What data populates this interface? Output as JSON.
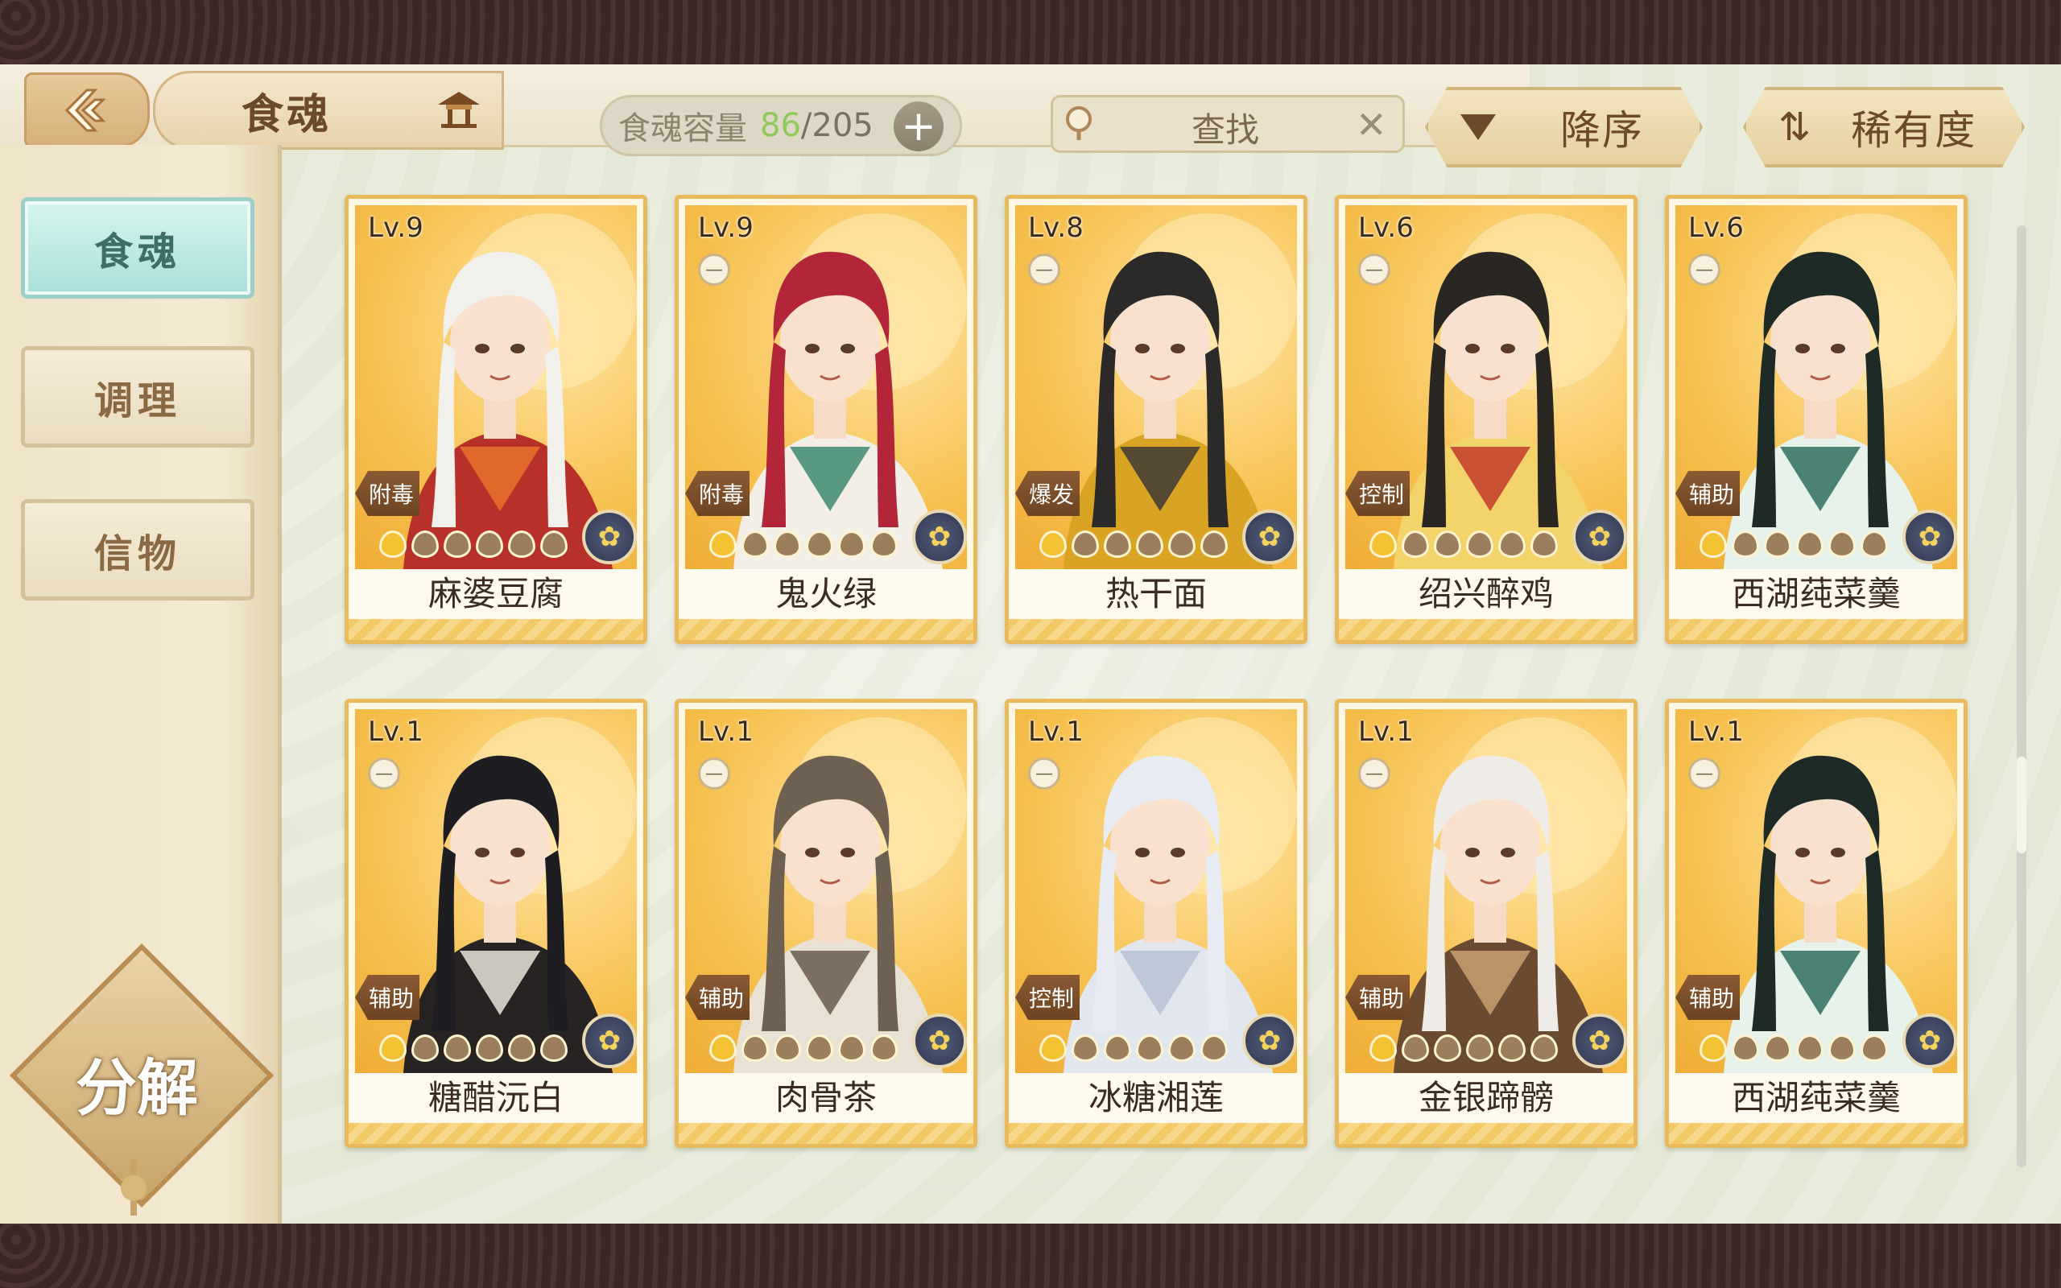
{
  "header": {
    "title": "食魂",
    "capacity_label": "食魂容量",
    "capacity_current": "86",
    "capacity_separator": "/",
    "capacity_max": "205",
    "add_symbol": "+",
    "search_placeholder": "查找",
    "clear_symbol": "✕",
    "sort_order_label": "降序",
    "sort_key_label": "稀有度"
  },
  "sidebar": {
    "tabs": [
      {
        "label": "食魂",
        "active": true
      },
      {
        "label": "调理",
        "active": false
      },
      {
        "label": "信物",
        "active": false
      }
    ],
    "decompose_label": "分解"
  },
  "cards": [
    {
      "level": "Lv.9",
      "name": "麻婆豆腐",
      "role": "附毒",
      "stars_lit": 1,
      "seal": "blue-flower-seal-icon",
      "palette": {
        "hair": "#f2f0ea",
        "outfit": "#b8302a",
        "accent": "#e8722c"
      }
    },
    {
      "level": "Lv.9",
      "name": "鬼火绿",
      "role": "附毒",
      "stars_lit": 1,
      "seal": "blue-flower-seal-icon",
      "palette": {
        "hair": "#b3263a",
        "outfit": "#f4efe6",
        "accent": "#3d8a6e"
      }
    },
    {
      "level": "Lv.8",
      "name": "热干面",
      "role": "爆发",
      "stars_lit": 1,
      "seal": "gold-flower-seal-icon",
      "palette": {
        "hair": "#2c2a28",
        "outfit": "#d9a424",
        "accent": "#3d3a36"
      }
    },
    {
      "level": "Lv.6",
      "name": "绍兴醉鸡",
      "role": "控制",
      "stars_lit": 1,
      "seal": "gold-flower-seal-icon",
      "palette": {
        "hair": "#2a2622",
        "outfit": "#f2d46a",
        "accent": "#c43a2a"
      }
    },
    {
      "level": "Lv.6",
      "name": "西湖莼菜羹",
      "role": "辅助",
      "stars_lit": 1,
      "seal": "gold-flower-seal-icon",
      "palette": {
        "hair": "#1e2a26",
        "outfit": "#e6f2ea",
        "accent": "#2f6e5e"
      }
    },
    {
      "level": "Lv.1",
      "name": "糖醋沅白",
      "role": "辅助",
      "stars_lit": 1,
      "seal": "gold-flower-seal-icon",
      "palette": {
        "hair": "#1e1e22",
        "outfit": "#262322",
        "accent": "#e9e4da"
      }
    },
    {
      "level": "Lv.1",
      "name": "肉骨茶",
      "role": "辅助",
      "stars_lit": 1,
      "seal": "gold-flower-seal-icon",
      "palette": {
        "hair": "#6e6152",
        "outfit": "#e9e2d4",
        "accent": "#6a5a4a"
      }
    },
    {
      "level": "Lv.1",
      "name": "冰糖湘莲",
      "role": "控制",
      "stars_lit": 1,
      "seal": "blue-flower-seal-icon",
      "palette": {
        "hair": "#e8ecf2",
        "outfit": "#e2e6ee",
        "accent": "#b8c2d4"
      }
    },
    {
      "level": "Lv.1",
      "name": "金银蹄髈",
      "role": "辅助",
      "stars_lit": 1,
      "seal": "blue-flower-seal-icon",
      "palette": {
        "hair": "#efebe6",
        "outfit": "#6a4a30",
        "accent": "#c9a070"
      }
    },
    {
      "level": "Lv.1",
      "name": "西湖莼菜羹",
      "role": "辅助",
      "stars_lit": 1,
      "seal": "blue-flower-seal-icon",
      "palette": {
        "hair": "#1e2a26",
        "outfit": "#e6f2ea",
        "accent": "#2f6e5e"
      }
    }
  ]
}
